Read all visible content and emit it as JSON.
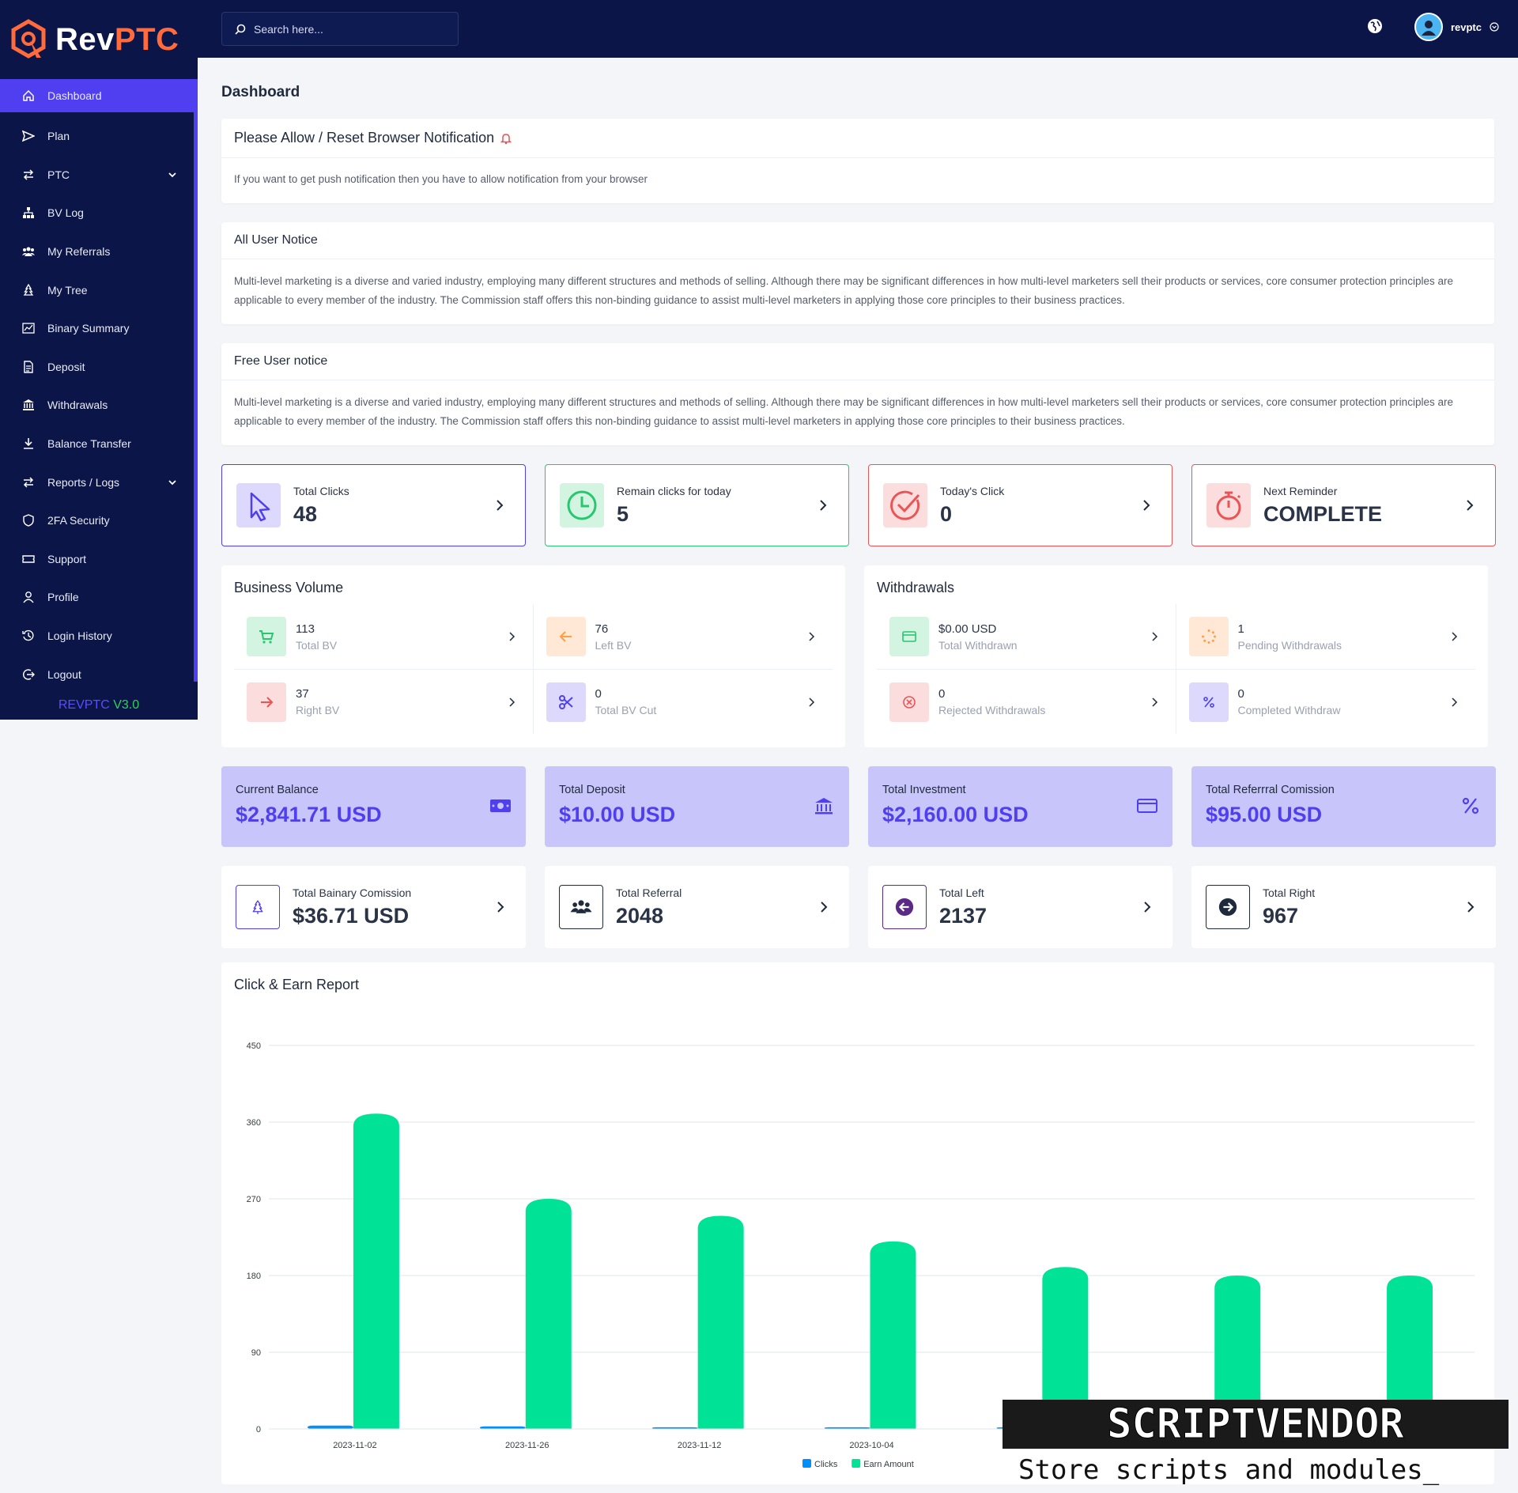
{
  "brand": {
    "part1": "Rev",
    "part2": "PTC"
  },
  "sidebar": {
    "items": [
      {
        "label": "Dashboard",
        "icon": "home-icon"
      },
      {
        "label": "Plan",
        "icon": "send-icon"
      },
      {
        "label": "PTC",
        "icon": "exchange-icon"
      },
      {
        "label": "BV Log",
        "icon": "sitemap-icon"
      },
      {
        "label": "My Referrals",
        "icon": "users-icon"
      },
      {
        "label": "My Tree",
        "icon": "tree-icon"
      },
      {
        "label": "Binary Summary",
        "icon": "chart-icon"
      },
      {
        "label": "Deposit",
        "icon": "file-icon"
      },
      {
        "label": "Withdrawals",
        "icon": "bank-icon"
      },
      {
        "label": "Balance Transfer",
        "icon": "download-icon"
      },
      {
        "label": "Reports / Logs",
        "icon": "exchange-icon"
      },
      {
        "label": "2FA Security",
        "icon": "shield-icon"
      },
      {
        "label": "Support",
        "icon": "ticket-icon"
      },
      {
        "label": "Profile",
        "icon": "user-icon"
      },
      {
        "label": "Login History",
        "icon": "history-icon"
      },
      {
        "label": "Logout",
        "icon": "logout-icon"
      }
    ],
    "version_a": "REVPTC",
    "version_b": "V3.0"
  },
  "topbar": {
    "search_placeholder": "Search here...",
    "username": "revptc"
  },
  "page_title": "Dashboard",
  "notices": [
    {
      "title": "Please Allow / Reset Browser Notification",
      "body": "If you want to get push notification then you have to allow notification from your browser"
    },
    {
      "title": "All User Notice",
      "body": "Multi-level marketing is a diverse and varied industry, employing many different structures and methods of selling. Although there may be significant differences in how multi-level marketers sell their products or services, core consumer protection principles are applicable to every member of the industry. The Commission staff offers this non-binding guidance to assist multi-level marketers in applying those core principles to their business practices."
    },
    {
      "title": "Free User notice",
      "body": "Multi-level marketing is a diverse and varied industry, employing many different structures and methods of selling. Although there may be significant differences in how multi-level marketers sell their products or services, core consumer protection principles are applicable to every member of the industry. The Commission staff offers this non-binding guidance to assist multi-level marketers in applying those core principles to their business practices."
    }
  ],
  "stats": [
    {
      "label": "Total Clicks",
      "value": "48",
      "color": "#4f3ff0"
    },
    {
      "label": "Remain clicks for today",
      "value": "5",
      "color": "#28c76f"
    },
    {
      "label": "Today's Click",
      "value": "0",
      "color": "#ea5455"
    },
    {
      "label": "Next Reminder",
      "value": "COMPLETE",
      "color": "#ea5455"
    }
  ],
  "business_volume": {
    "title": "Business Volume",
    "items": [
      {
        "value": "113",
        "label": "Total BV"
      },
      {
        "value": "76",
        "label": "Left BV"
      },
      {
        "value": "37",
        "label": "Right BV"
      },
      {
        "value": "0",
        "label": "Total BV Cut"
      }
    ]
  },
  "withdrawals": {
    "title": "Withdrawals",
    "items": [
      {
        "value": "$0.00 USD",
        "label": "Total Withdrawn"
      },
      {
        "value": "1",
        "label": "Pending Withdrawals"
      },
      {
        "value": "0",
        "label": "Rejected Withdrawals"
      },
      {
        "value": "0",
        "label": "Completed Withdraw"
      }
    ]
  },
  "balances": [
    {
      "label": "Current Balance",
      "value": "$2,841.71 USD",
      "icon": "money-icon"
    },
    {
      "label": "Total Deposit",
      "value": "$10.00 USD",
      "icon": "bank-icon"
    },
    {
      "label": "Total Investment",
      "value": "$2,160.00 USD",
      "icon": "card-icon"
    },
    {
      "label": "Total Referrral Comission",
      "value": "$95.00 USD",
      "icon": "percent-icon"
    }
  ],
  "totals": [
    {
      "label": "Total Bainary Comission",
      "value": "$36.71 USD"
    },
    {
      "label": "Total Referral",
      "value": "2048"
    },
    {
      "label": "Total Left",
      "value": "2137"
    },
    {
      "label": "Total Right",
      "value": "967"
    }
  ],
  "chart_title": "Click & Earn Report",
  "chart_data": {
    "type": "bar",
    "title": "Click & Earn Report",
    "categories": [
      "2023-11-02",
      "2023-11-26",
      "2023-11-12",
      "2023-10-04",
      "",
      "",
      ""
    ],
    "series": [
      {
        "name": "Clicks",
        "color": "#008ffb",
        "values": [
          4,
          3,
          2,
          2,
          2,
          2,
          2
        ]
      },
      {
        "name": "Earn Amount",
        "color": "#00e396",
        "values": [
          370,
          270,
          250,
          220,
          190,
          180,
          180
        ]
      }
    ],
    "ylim": [
      0,
      450
    ],
    "yticks": [
      0,
      90,
      180,
      270,
      360,
      450
    ],
    "legend": "bottom-center",
    "grid": true
  },
  "watermark": {
    "title": "SCRIPTVENDOR",
    "subtitle": "Store scripts and modules_"
  }
}
